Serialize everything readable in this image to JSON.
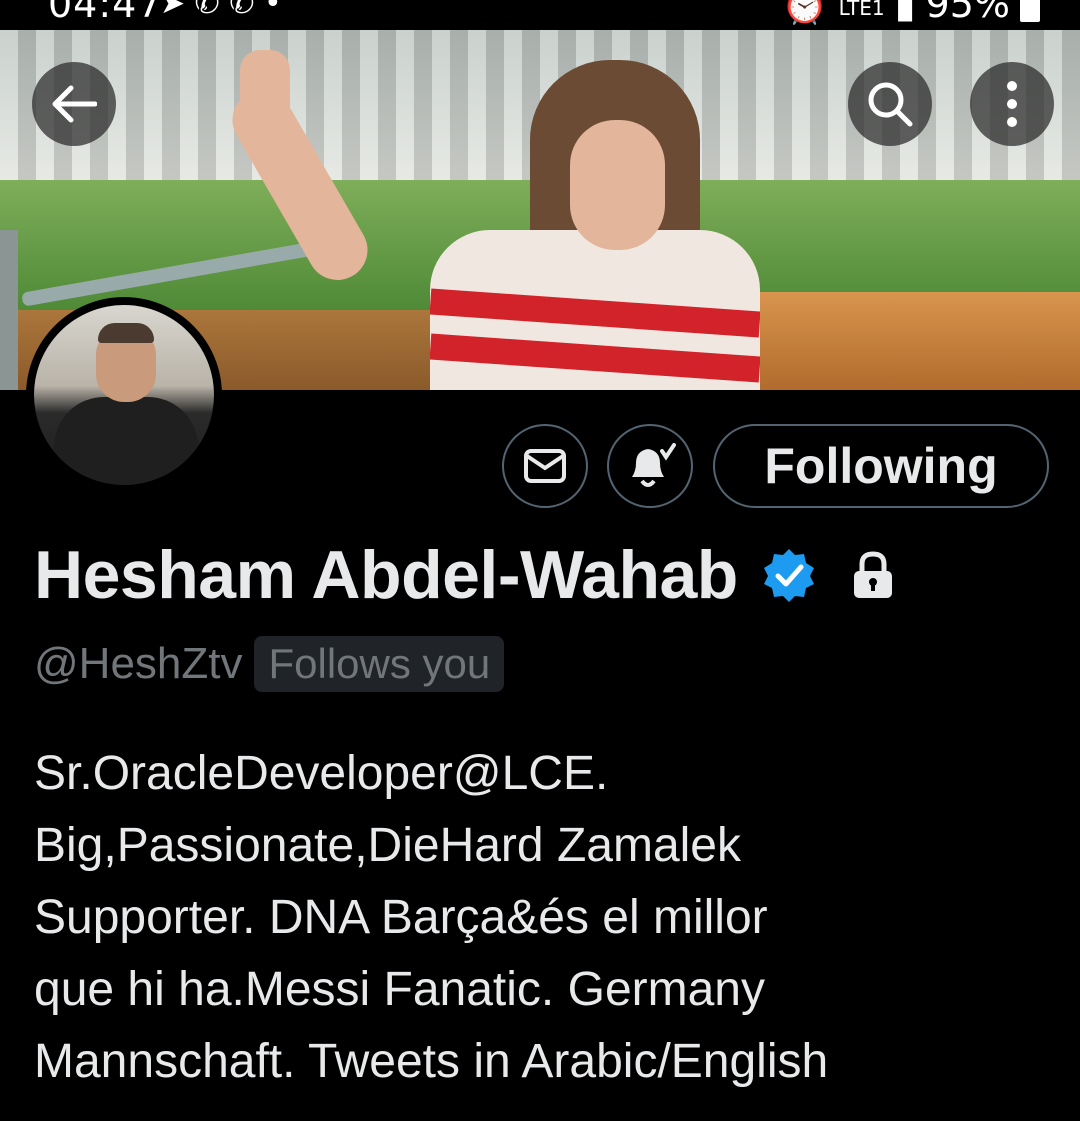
{
  "status_bar": {
    "time": "04:47",
    "network_label": "LTE1",
    "battery": "95%"
  },
  "header": {
    "back_icon": "arrow-left-icon",
    "search_icon": "search-icon",
    "more_icon": "more-vertical-icon"
  },
  "profile": {
    "display_name": "Hesham Abdel-Wahab",
    "handle": "@HeshZtv",
    "follows_you": "Follows you",
    "verified_color": "#1d9bf0",
    "follow_button_label": "Following",
    "bio_lines": [
      "Sr.OracleDeveloper@LCE.",
      "Big,Passionate,DieHard Zamalek",
      "Supporter. DNA Barça&és el millor",
      "que hi ha.Messi Fanatic. Germany",
      "Mannschaft. Tweets in Arabic/English"
    ]
  }
}
